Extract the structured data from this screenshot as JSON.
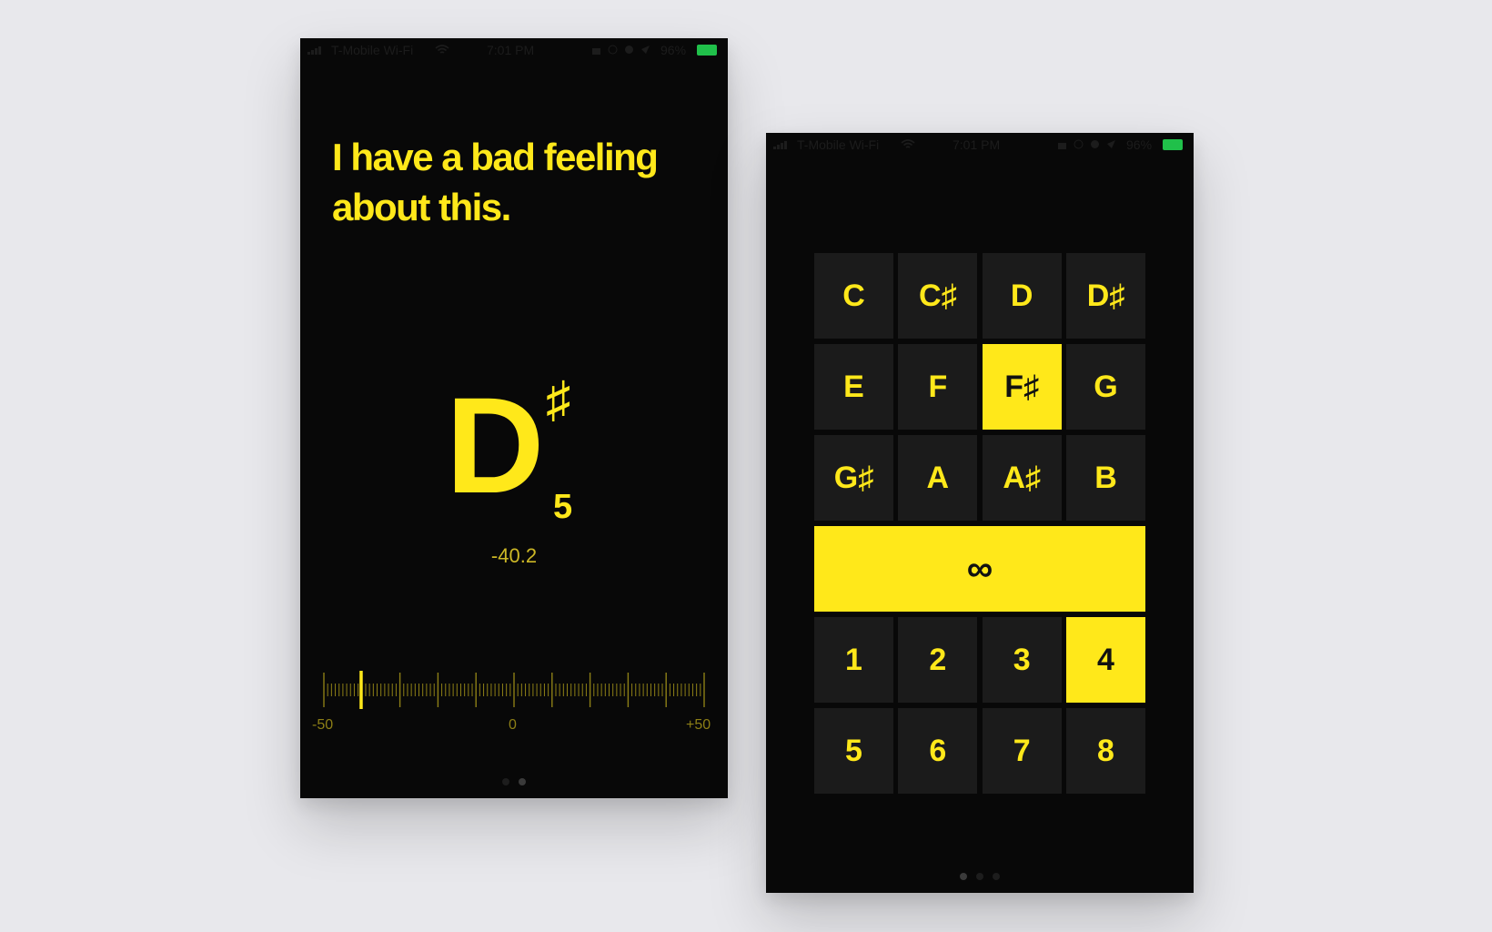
{
  "status_bar": {
    "carrier": "T-Mobile Wi-Fi",
    "time": "7:01 PM",
    "battery": "96%"
  },
  "tuner": {
    "headline": "I have a bad feeling about this.",
    "note": "D",
    "accidental": "♯",
    "octave": "5",
    "cents": "-40.2",
    "meter_value": -40.2,
    "scale_min": "-50",
    "scale_mid": "0",
    "scale_max": "+50"
  },
  "picker": {
    "notes": [
      {
        "label": "C",
        "name": "note-key-c"
      },
      {
        "label": "C♯",
        "name": "note-key-c-sharp"
      },
      {
        "label": "D",
        "name": "note-key-d"
      },
      {
        "label": "D♯",
        "name": "note-key-d-sharp"
      },
      {
        "label": "E",
        "name": "note-key-e"
      },
      {
        "label": "F",
        "name": "note-key-f"
      },
      {
        "label": "F♯",
        "name": "note-key-f-sharp",
        "selected": true
      },
      {
        "label": "G",
        "name": "note-key-g"
      },
      {
        "label": "G♯",
        "name": "note-key-g-sharp"
      },
      {
        "label": "A",
        "name": "note-key-a"
      },
      {
        "label": "A♯",
        "name": "note-key-a-sharp"
      },
      {
        "label": "B",
        "name": "note-key-b"
      }
    ],
    "infinity_label": "∞",
    "numbers": [
      {
        "label": "1",
        "name": "number-key-1"
      },
      {
        "label": "2",
        "name": "number-key-2"
      },
      {
        "label": "3",
        "name": "number-key-3"
      },
      {
        "label": "4",
        "name": "number-key-4",
        "selected": true
      },
      {
        "label": "5",
        "name": "number-key-5"
      },
      {
        "label": "6",
        "name": "number-key-6"
      },
      {
        "label": "7",
        "name": "number-key-7"
      },
      {
        "label": "8",
        "name": "number-key-8"
      }
    ]
  },
  "colors": {
    "accent": "#ffe81a",
    "screen_bg": "#080808",
    "key_bg": "#1b1b1b",
    "meter_tick": "#8d7f16"
  }
}
